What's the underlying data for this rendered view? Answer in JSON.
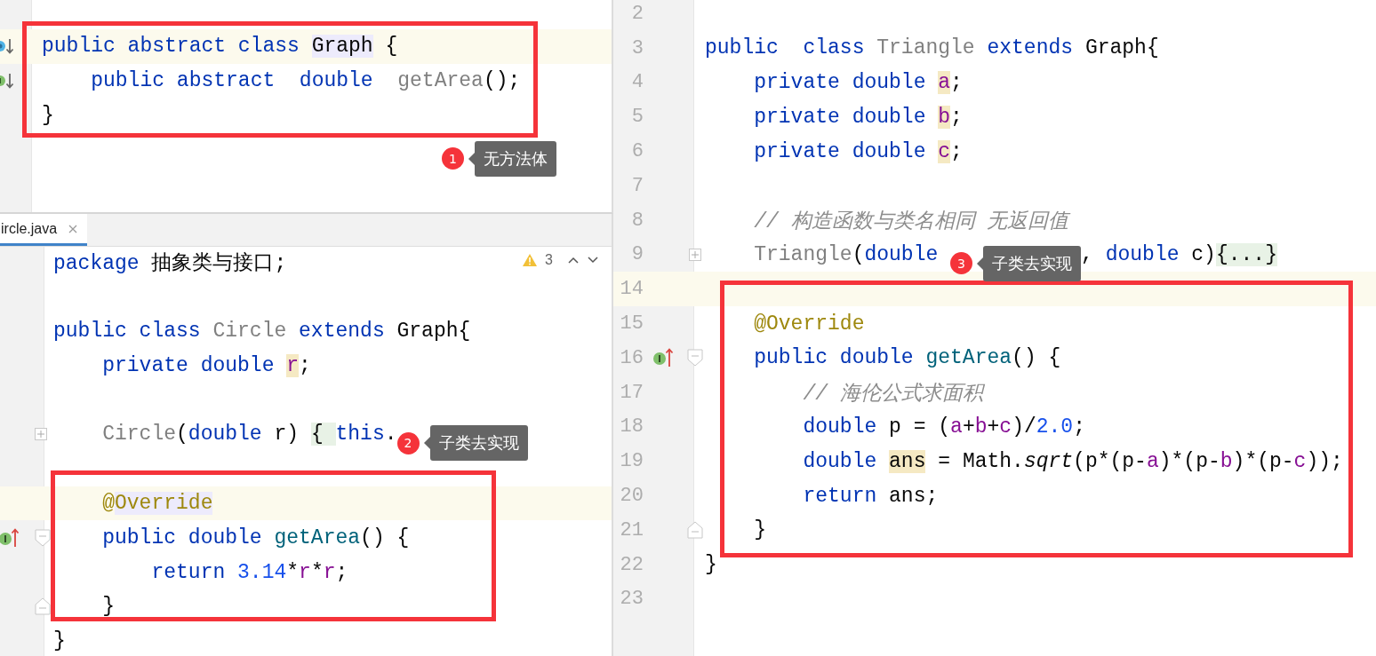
{
  "panes": [
    {
      "kind": "top",
      "blocks": [
        {
          "framed": false,
          "lines": [
            {
              "current": false
            }
          ]
        },
        {
          "framed": true,
          "lines": [
            {
              "current": true,
              "gutter": {
                "kind": "class-down"
              },
              "tokens": [
                {
                  "text": "public abstract class ",
                  "kind": "kw"
                },
                {
                  "text": "Graph",
                  "kind": "plain",
                  "highlight": {
                    "kind": "type"
                  }
                },
                {
                  "text": " {",
                  "kind": "plain"
                }
              ]
            },
            {
              "current": false,
              "gutter": {
                "kind": "method-down"
              },
              "tokens": [
                {
                  "text": "    public abstract  double  ",
                  "kind": "kw"
                },
                {
                  "text": "getArea",
                  "kind": "gray"
                },
                {
                  "text": "();",
                  "kind": "plain"
                }
              ]
            },
            {
              "current": false,
              "tokens": [
                {
                  "text": "}",
                  "kind": "plain"
                }
              ]
            }
          ]
        },
        {
          "framed": false,
          "lines": [
            {
              "current": false,
              "tokens": [
                {
                  "kind": "callout",
                  "number": "1",
                  "text": "无方法体"
                }
              ]
            }
          ]
        }
      ]
    },
    {
      "kind": "bottom",
      "tab": {
        "label": "ircle.java",
        "selected": true
      },
      "inspection": {
        "count": "3"
      },
      "blocks": [
        {
          "framed": false,
          "lines": [
            {
              "current": false,
              "tokens": [
                {
                  "text": "package",
                  "kind": "kw"
                },
                {
                  "text": " 抽象类与接口;",
                  "kind": "plain"
                }
              ]
            },
            {
              "current": false
            },
            {
              "current": false,
              "tokens": [
                {
                  "text": "public class ",
                  "kind": "kw"
                },
                {
                  "text": "Circle",
                  "kind": "gray"
                },
                {
                  "text": " extends ",
                  "kind": "kw"
                },
                {
                  "text": "Graph{",
                  "kind": "plain"
                }
              ]
            },
            {
              "current": false,
              "tokens": [
                {
                  "text": "    private double ",
                  "kind": "kw"
                },
                {
                  "text": "r",
                  "kind": "field",
                  "highlight": {
                    "kind": "read"
                  }
                },
                {
                  "text": ";",
                  "kind": "plain"
                }
              ]
            },
            {
              "current": false
            },
            {
              "current": false,
              "fold": {
                "kind": "plus"
              },
              "tokens": [
                {
                  "text": "    Circle",
                  "kind": "gray"
                },
                {
                  "text": "(",
                  "kind": "plain"
                },
                {
                  "text": "double",
                  "kind": "kw"
                },
                {
                  "text": " r) ",
                  "kind": "plain"
                },
                {
                  "text": "{ ",
                  "kind": "plain",
                  "highlight": {
                    "kind": "fold"
                  }
                },
                {
                  "text": "this",
                  "kind": "kw"
                },
                {
                  "text": ".",
                  "kind": "plain"
                },
                {
                  "kind": "callout",
                  "number": "2",
                  "text": "子类去实现"
                }
              ]
            },
            {
              "current": false
            }
          ]
        },
        {
          "framed": true,
          "lines": [
            {
              "current": true,
              "tokens": [
                {
                  "text": "    @",
                  "kind": "annot"
                },
                {
                  "text": "Override",
                  "kind": "annot",
                  "highlight": {
                    "kind": "type"
                  }
                }
              ]
            },
            {
              "current": false,
              "gutter": {
                "kind": "up"
              },
              "fold": {
                "kind": "start"
              },
              "tokens": [
                {
                  "text": "    public double ",
                  "kind": "kw"
                },
                {
                  "text": "getArea",
                  "kind": "method"
                },
                {
                  "text": "() {",
                  "kind": "plain"
                }
              ]
            },
            {
              "current": false,
              "tokens": [
                {
                  "text": "        return ",
                  "kind": "kw"
                },
                {
                  "text": "3.14",
                  "kind": "num"
                },
                {
                  "text": "*",
                  "kind": "plain"
                },
                {
                  "text": "r",
                  "kind": "field"
                },
                {
                  "text": "*",
                  "kind": "plain"
                },
                {
                  "text": "r",
                  "kind": "field"
                },
                {
                  "text": ";",
                  "kind": "plain"
                }
              ]
            },
            {
              "current": false,
              "fold": {
                "kind": "end"
              },
              "tokens": [
                {
                  "text": "    }",
                  "kind": "plain"
                }
              ]
            }
          ]
        },
        {
          "framed": false,
          "lines": [
            {
              "current": false,
              "tokens": [
                {
                  "text": "}",
                  "kind": "plain"
                }
              ]
            }
          ]
        }
      ]
    },
    {
      "kind": "right",
      "blocks": [
        {
          "framed": false,
          "lines": [
            {
              "number": "2",
              "current": false
            },
            {
              "number": "3",
              "current": false,
              "tokens": [
                {
                  "text": "public  class ",
                  "kind": "kw"
                },
                {
                  "text": "Triangle",
                  "kind": "gray"
                },
                {
                  "text": " extends ",
                  "kind": "kw"
                },
                {
                  "text": "Graph{",
                  "kind": "plain"
                }
              ]
            },
            {
              "number": "4",
              "current": false,
              "tokens": [
                {
                  "text": "    private double ",
                  "kind": "kw"
                },
                {
                  "text": "a",
                  "kind": "field",
                  "highlight": {
                    "kind": "read"
                  }
                },
                {
                  "text": ";",
                  "kind": "plain"
                }
              ]
            },
            {
              "number": "5",
              "current": false,
              "tokens": [
                {
                  "text": "    private double ",
                  "kind": "kw"
                },
                {
                  "text": "b",
                  "kind": "field",
                  "highlight": {
                    "kind": "read"
                  }
                },
                {
                  "text": ";",
                  "kind": "plain"
                }
              ]
            },
            {
              "number": "6",
              "current": false,
              "tokens": [
                {
                  "text": "    private double ",
                  "kind": "kw"
                },
                {
                  "text": "c",
                  "kind": "field",
                  "highlight": {
                    "kind": "read"
                  }
                },
                {
                  "text": ";",
                  "kind": "plain"
                }
              ]
            },
            {
              "number": "7",
              "current": false
            },
            {
              "number": "8",
              "current": false,
              "tokens": [
                {
                  "text": "    // 构造函数与类名相同 无返回值",
                  "kind": "comment"
                }
              ]
            },
            {
              "number": "9",
              "current": false,
              "fold": {
                "kind": "plus"
              },
              "tokens": [
                {
                  "text": "    Triangle",
                  "kind": "gray"
                },
                {
                  "text": "(",
                  "kind": "plain"
                },
                {
                  "text": "double ",
                  "kind": "kw"
                },
                {
                  "kind": "callout",
                  "number": "3",
                  "text": "子类去实现"
                },
                {
                  "text": ", ",
                  "kind": "plain"
                },
                {
                  "text": "double",
                  "kind": "kw"
                },
                {
                  "text": " c)",
                  "kind": "plain"
                },
                {
                  "text": "{...}",
                  "kind": "plain",
                  "highlight": {
                    "kind": "fold"
                  }
                }
              ]
            }
          ]
        },
        {
          "framed": true,
          "lines": [
            {
              "number": "14",
              "current": true
            },
            {
              "number": "15",
              "current": false,
              "tokens": [
                {
                  "text": "    @Override",
                  "kind": "annot"
                }
              ]
            },
            {
              "number": "16",
              "current": false,
              "gutter": {
                "kind": "up"
              },
              "fold": {
                "kind": "start"
              },
              "tokens": [
                {
                  "text": "    public double ",
                  "kind": "kw"
                },
                {
                  "text": "getArea",
                  "kind": "method"
                },
                {
                  "text": "() {",
                  "kind": "plain"
                }
              ]
            },
            {
              "number": "17",
              "current": false,
              "tokens": [
                {
                  "text": "        // 海伦公式求面积",
                  "kind": "comment"
                }
              ]
            },
            {
              "number": "18",
              "current": false,
              "tokens": [
                {
                  "text": "        double ",
                  "kind": "kw"
                },
                {
                  "text": "p = (",
                  "kind": "plain"
                },
                {
                  "text": "a",
                  "kind": "field"
                },
                {
                  "text": "+",
                  "kind": "plain"
                },
                {
                  "text": "b",
                  "kind": "field"
                },
                {
                  "text": "+",
                  "kind": "plain"
                },
                {
                  "text": "c",
                  "kind": "field"
                },
                {
                  "text": ")/",
                  "kind": "plain"
                },
                {
                  "text": "2.0",
                  "kind": "num"
                },
                {
                  "text": ";",
                  "kind": "plain"
                }
              ]
            },
            {
              "number": "19",
              "current": false,
              "tokens": [
                {
                  "text": "        double ",
                  "kind": "kw"
                },
                {
                  "text": "ans",
                  "kind": "plain",
                  "highlight": {
                    "kind": "read"
                  }
                },
                {
                  "text": " = Math.",
                  "kind": "plain"
                },
                {
                  "text": "sqrt",
                  "kind": "static"
                },
                {
                  "text": "(p*(p-",
                  "kind": "plain"
                },
                {
                  "text": "a",
                  "kind": "field"
                },
                {
                  "text": ")*(p-",
                  "kind": "plain"
                },
                {
                  "text": "b",
                  "kind": "field"
                },
                {
                  "text": ")*(p-",
                  "kind": "plain"
                },
                {
                  "text": "c",
                  "kind": "field"
                },
                {
                  "text": "));",
                  "kind": "plain"
                }
              ]
            },
            {
              "number": "20",
              "current": false,
              "tokens": [
                {
                  "text": "        return ",
                  "kind": "kw"
                },
                {
                  "text": "ans;",
                  "kind": "plain"
                }
              ]
            },
            {
              "number": "21",
              "current": false,
              "fold": {
                "kind": "end"
              },
              "tokens": [
                {
                  "text": "    }",
                  "kind": "plain"
                }
              ]
            }
          ]
        },
        {
          "framed": false,
          "lines": [
            {
              "number": "22",
              "current": false,
              "tokens": [
                {
                  "text": "}",
                  "kind": "plain"
                }
              ]
            },
            {
              "number": "23",
              "current": false
            }
          ]
        }
      ]
    }
  ]
}
